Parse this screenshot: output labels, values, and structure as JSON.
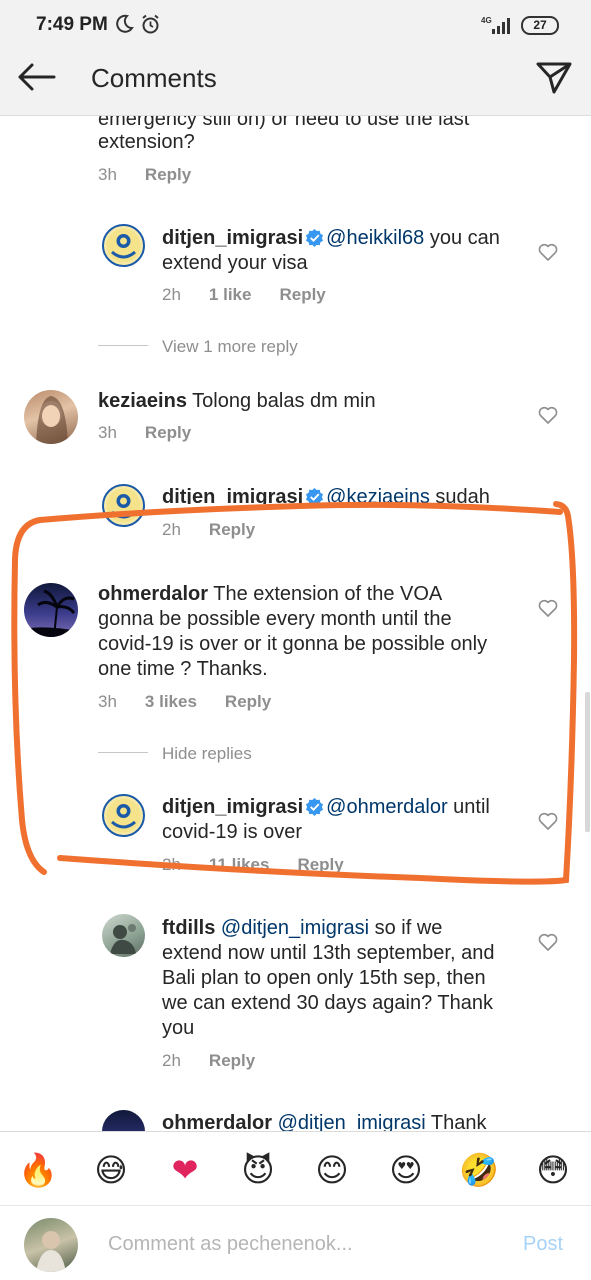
{
  "status": {
    "time": "7:49 PM",
    "network": "4G",
    "battery": "27"
  },
  "header": {
    "title": "Comments"
  },
  "comments": [
    {
      "text_line1": "emergency still on) or need to use the last",
      "text_line2": "extension?",
      "time": "3h",
      "reply": "Reply"
    },
    {
      "username": "ditjen_imigrasi",
      "mention": "@heikkil68",
      "text_a": " you can",
      "text_line2": "extend your visa",
      "time": "2h",
      "likes": "1 like",
      "reply": "Reply"
    },
    {
      "view_more": "View 1 more reply"
    },
    {
      "username": "keziaeins",
      "text": " Tolong balas dm min",
      "time": "3h",
      "reply": "Reply"
    },
    {
      "username": "ditjen_imigrasi",
      "mention": "@keziaeins",
      "text_a": " sudah",
      "time": "2h",
      "reply": "Reply"
    },
    {
      "username": "ohmerdalor",
      "text_a": " The extension of the VOA",
      "text_line2": "gonna be possible every month until the",
      "text_line3": "covid-19 is over or it gonna be possible only",
      "text_line4": "one time ? Thanks.",
      "time": "3h",
      "likes": "3 likes",
      "reply": "Reply"
    },
    {
      "hide_replies": "Hide replies"
    },
    {
      "username": "ditjen_imigrasi",
      "mention": "@ohmerdalor",
      "text_a": " until",
      "text_line2": "covid-19 is over",
      "time": "2h",
      "likes": "11 likes",
      "reply": "Reply"
    },
    {
      "username": "ftdills",
      "mention": "@ditjen_imigrasi",
      "text_a": " so if we",
      "text_line2": "extend now until 13th september, and",
      "text_line3": "Bali plan to open only 15th sep, then",
      "text_line4": "we can extend 30 days again? Thank",
      "text_line5": "you",
      "time": "2h",
      "reply": "Reply"
    },
    {
      "username": "ohmerdalor",
      "mention": "@ditjen_imigrasi",
      "text_a": " Thank"
    }
  ],
  "emojis": [
    "🔥",
    "😅",
    "❤",
    "😈",
    "😊",
    "😍",
    "🤣",
    "😳"
  ],
  "composer": {
    "placeholder": "Comment as pechenenok...",
    "post": "Post"
  },
  "colors": {
    "annotation": "#f07030",
    "mention": "#00376b",
    "verified": "#3897f0"
  }
}
